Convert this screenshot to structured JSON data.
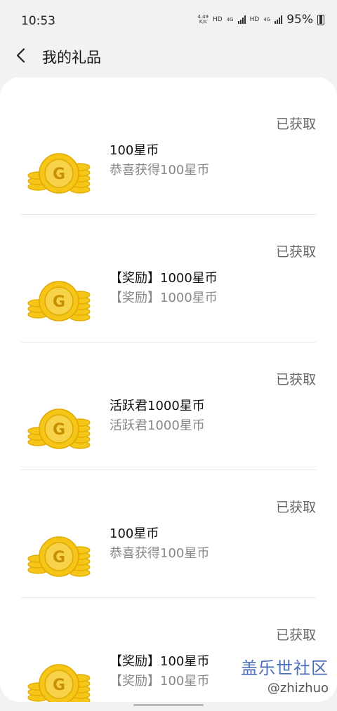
{
  "status_bar": {
    "time": "10:53",
    "net_speed_value": "4.49",
    "net_speed_unit": "K/s",
    "hd1": "HD",
    "net1": "4G",
    "hd2": "HD",
    "net2": "4G",
    "battery": "95%"
  },
  "header": {
    "title": "我的礼品"
  },
  "gifts": [
    {
      "title": "100星币",
      "subtitle": "恭喜获得100星币",
      "status": "已获取"
    },
    {
      "title": "【奖励】1000星币",
      "subtitle": "【奖励】1000星币",
      "status": "已获取"
    },
    {
      "title": "活跃君1000星币",
      "subtitle": "活跃君1000星币",
      "status": "已获取"
    },
    {
      "title": "100星币",
      "subtitle": "恭喜获得100星币",
      "status": "已获取"
    },
    {
      "title": "【奖励】100星币",
      "subtitle": "【奖励】100星币",
      "status": "已获取"
    }
  ],
  "watermark": {
    "brand": "盖乐世社区",
    "handle": "@zhizhuo"
  },
  "icons": {
    "back": "chevron-left-icon",
    "coin": "coin-stack-icon",
    "coin_letter": "G"
  },
  "colors": {
    "coin_gold": "#f5c518",
    "coin_dark": "#e0a800",
    "muted_text": "#888888"
  }
}
